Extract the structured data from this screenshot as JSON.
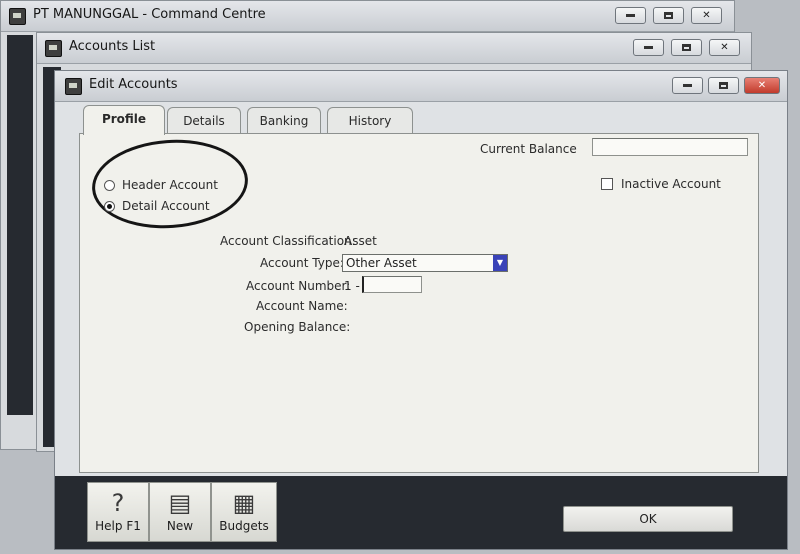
{
  "command_centre": {
    "title": "PT MANUNGGAL - Command Centre"
  },
  "accounts_list": {
    "title": "Accounts List"
  },
  "edit_accounts": {
    "title": "Edit Accounts",
    "tabs": [
      {
        "label": "Profile",
        "active": true
      },
      {
        "label": "Details",
        "active": false
      },
      {
        "label": "Banking",
        "active": false
      },
      {
        "label": "History",
        "active": false
      }
    ],
    "current_balance_label": "Current Balance",
    "current_balance_value": "",
    "header_account_label": "Header Account",
    "detail_account_label": "Detail Account",
    "selected_account_kind": "Detail Account",
    "inactive_account_label": "Inactive Account",
    "inactive_checked": false,
    "classification_label": "Account Classification:",
    "classification_value": "Asset",
    "type_label": "Account Type:",
    "type_value": "Other Asset",
    "number_label": "Account Number:",
    "number_prefix": "1 -",
    "number_value": "",
    "name_label": "Account Name:",
    "opening_label": "Opening Balance:",
    "toolbar": [
      {
        "label": "Help F1",
        "icon": "help-icon"
      },
      {
        "label": "New",
        "icon": "new-icon"
      },
      {
        "label": "Budgets",
        "icon": "budgets-icon"
      }
    ],
    "ok_label": "OK"
  },
  "colors": {
    "close_button": "#c13b2c",
    "dropdown_arrow": "#3a43b8",
    "dark_bg": "#262a30"
  }
}
